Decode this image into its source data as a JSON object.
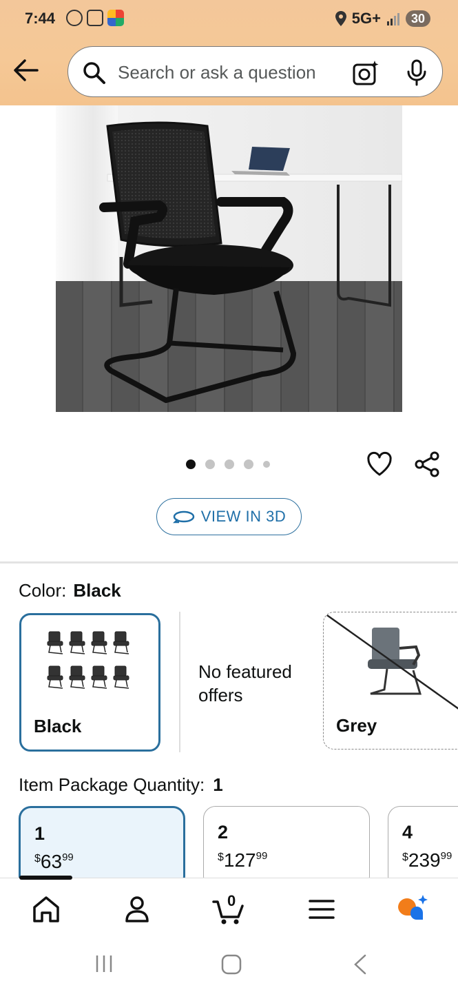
{
  "status_bar": {
    "time": "7:44",
    "network": "5G+",
    "battery": "30"
  },
  "search": {
    "placeholder": "Search or ask a question"
  },
  "gallery": {
    "dot_count": 5,
    "active_index": 0,
    "view_3d_label": "VIEW IN 3D"
  },
  "color": {
    "label": "Color:",
    "selected": "Black",
    "options": [
      {
        "name": "Black"
      },
      {
        "name": "Grey"
      }
    ],
    "no_offers_text": "No featured offers"
  },
  "quantity": {
    "label": "Item Package Quantity:",
    "selected": "1",
    "options": [
      {
        "qty": "1",
        "currency": "$",
        "dollars": "63",
        "cents": "99"
      },
      {
        "qty": "2",
        "currency": "$",
        "dollars": "127",
        "cents": "99"
      },
      {
        "qty": "4",
        "currency": "$",
        "dollars": "239",
        "cents": "99"
      }
    ]
  },
  "bottom_nav": {
    "cart_count": "0",
    "items": [
      "home-icon",
      "account-icon",
      "cart-icon",
      "menu-icon",
      "rufus-icon"
    ]
  },
  "colors": {
    "accent": "#2a6f9d",
    "header": "#f5c896",
    "link": "#1f6fa8"
  }
}
